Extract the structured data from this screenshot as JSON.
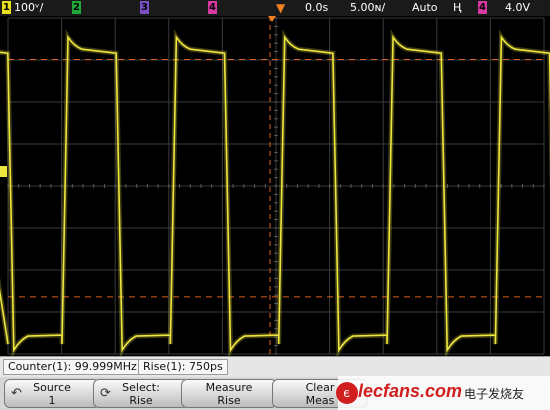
{
  "status_bar": {
    "ch1": {
      "num": "1",
      "scale": "100ᵛ/",
      "color": "#e8e020"
    },
    "ch2": {
      "num": "2",
      "color": "#1fa83a"
    },
    "ch3": {
      "num": "3",
      "color": "#7a4fc4"
    },
    "ch4": {
      "num": "4",
      "color": "#d63aa0"
    },
    "trigger_icon": "trigger-marker-icon",
    "time_offset": "0.0s",
    "time_scale": "5.00ɴ/",
    "trigger_mode": "Auto",
    "trigger_slope": "Ⱨ",
    "trigger_source": "4",
    "trigger_level": "4.0V"
  },
  "waveform": {
    "channel": "1",
    "color": "#f0e640",
    "period_fraction_of_screen": 0.197,
    "high_level_fraction": 0.08,
    "low_level_fraction": 0.965,
    "dashed_cursors_color": "#d86020",
    "cursor_levels_fraction": [
      0.128,
      0.826
    ],
    "ground_marker": "1"
  },
  "measurements": {
    "counter": "Counter(1): 99.999MHz",
    "rise": "Rise(1): 750ps"
  },
  "softkeys": [
    {
      "line1": "Source",
      "line2": "1",
      "icon": "return-arrow-icon"
    },
    {
      "line1": "Select:",
      "line2": "Rise",
      "icon": "rotate-knob-icon"
    },
    {
      "line1": "Measure",
      "line2": "Rise",
      "icon": ""
    },
    {
      "line1": "Clear",
      "line2": "Meas",
      "icon": ""
    }
  ],
  "watermark": {
    "brand": "elecfans.com",
    "subtitle": "电子发烧友"
  }
}
